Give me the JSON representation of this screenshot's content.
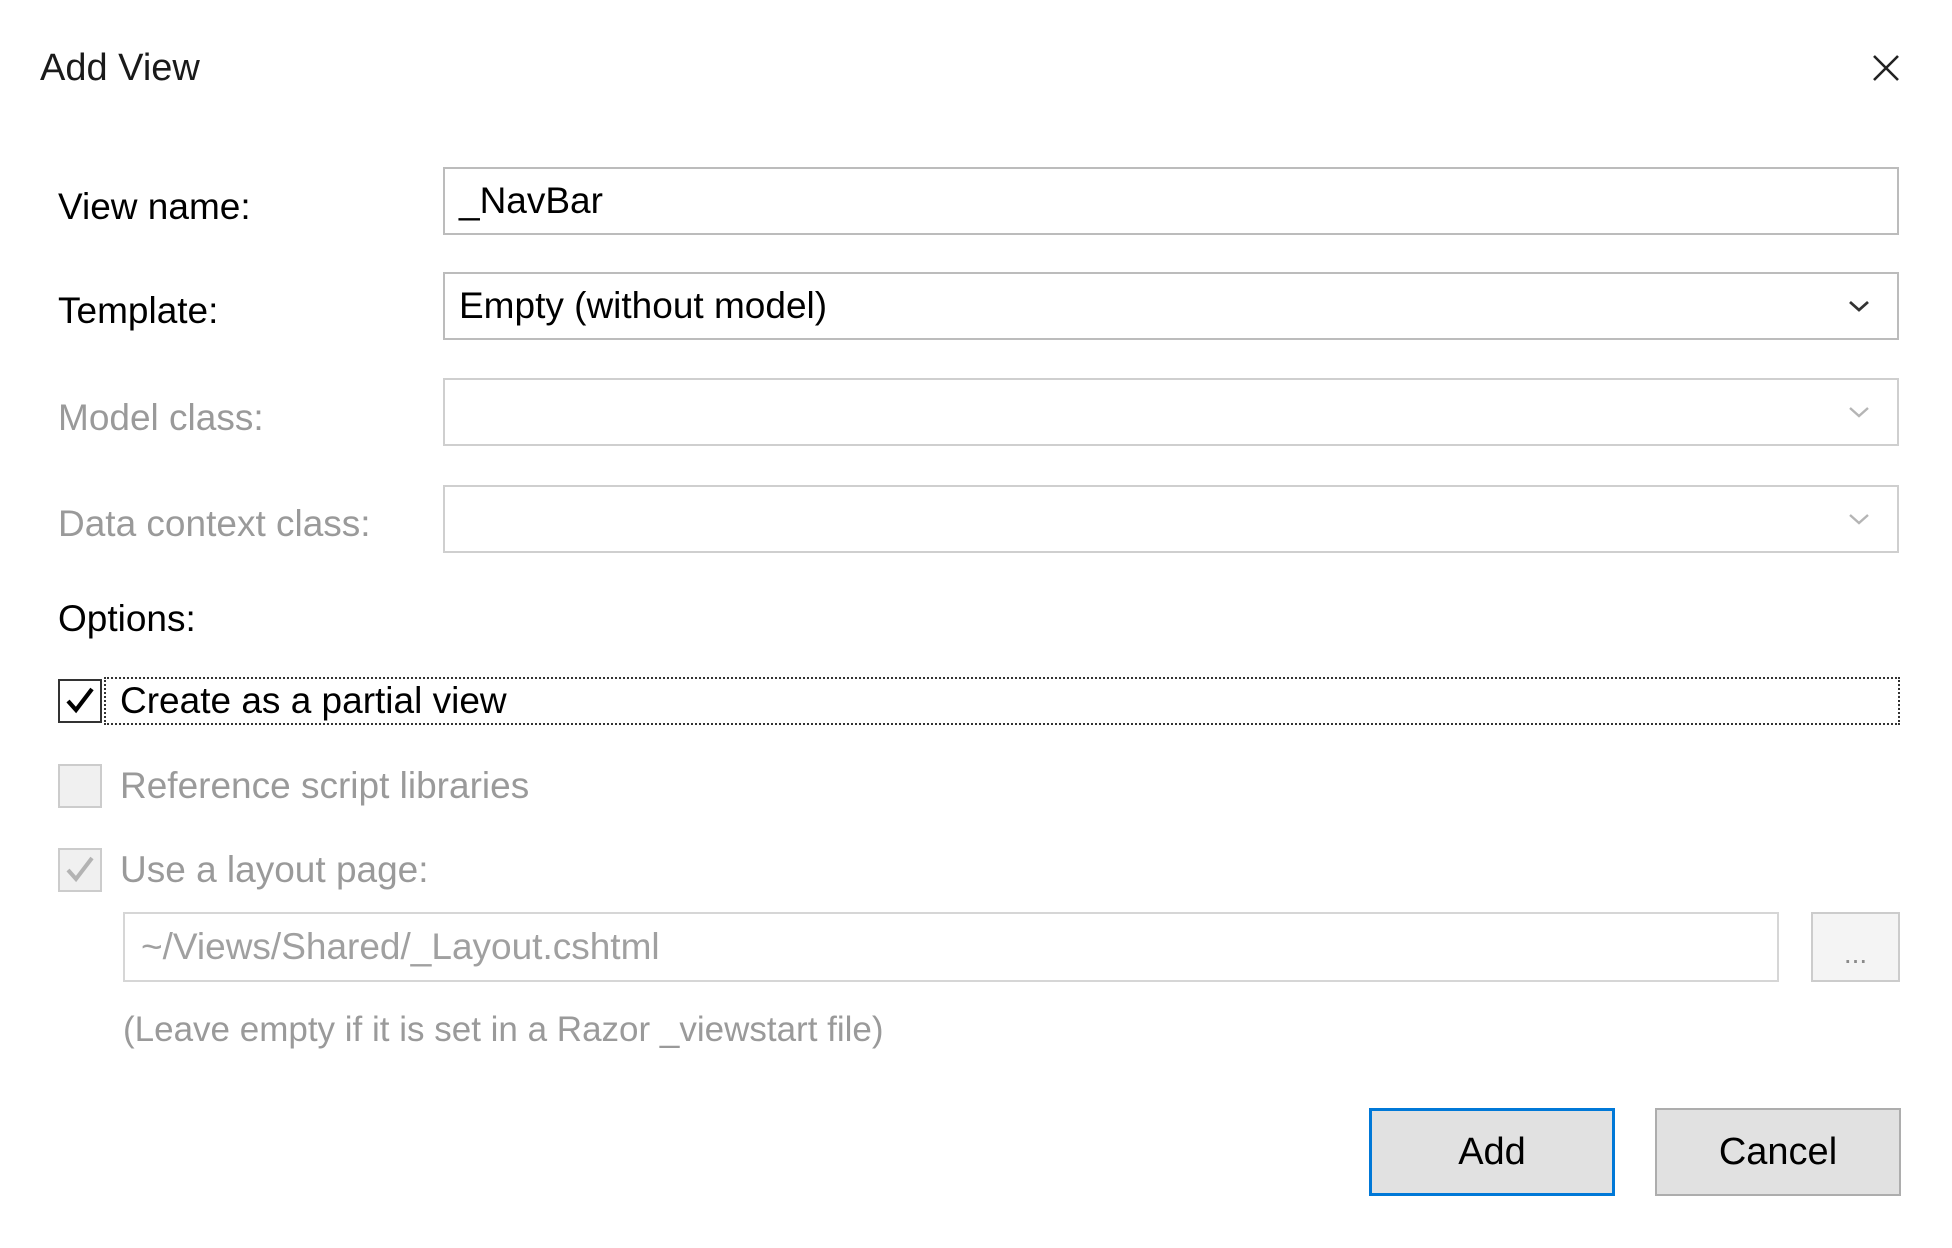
{
  "dialog": {
    "title": "Add View",
    "close_icon": "close-icon"
  },
  "fields": {
    "view_name": {
      "label": "View name:",
      "value": "_NavBar"
    },
    "template": {
      "label": "Template:",
      "selected": "Empty (without model)",
      "icon": "chevron-down-icon"
    },
    "model_class": {
      "label": "Model class:",
      "selected": "",
      "disabled": true,
      "icon": "chevron-down-icon"
    },
    "data_context_class": {
      "label": "Data context class:",
      "selected": "",
      "disabled": true,
      "icon": "chevron-down-icon"
    }
  },
  "options": {
    "heading": "Options:",
    "partial_view": {
      "label": "Create as a partial view",
      "checked": true,
      "focused": true
    },
    "reference_scripts": {
      "label": "Reference script libraries",
      "checked": false,
      "disabled": true
    },
    "use_layout": {
      "label": "Use a layout page:",
      "checked": true,
      "disabled": true
    }
  },
  "layout": {
    "path_placeholder": "~/Views/Shared/_Layout.cshtml",
    "browse_label": "...",
    "hint": "(Leave empty if it is set in a Razor _viewstart file)"
  },
  "buttons": {
    "add_label": "Add",
    "cancel_label": "Cancel"
  },
  "colors": {
    "accent": "#0078d7",
    "disabled_text": "#9a9a9a",
    "button_bg": "#e1e1e1"
  }
}
